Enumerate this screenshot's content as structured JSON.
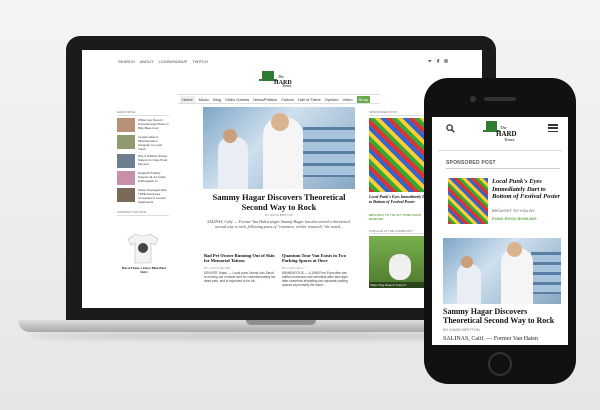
{
  "site": {
    "logo_top": "The",
    "logo_main": "HARD",
    "logo_bottom": "Times"
  },
  "desktop": {
    "topbar": [
      "SEARCH",
      "ABOUT",
      "LOGIN/SIGNUP",
      "TWITCH"
    ],
    "social_icons": [
      "twitter-icon",
      "facebook-icon",
      "instagram-icon"
    ],
    "nav": [
      "Home",
      "Music",
      "Blog",
      "Video Games",
      "News/Politics",
      "Culture",
      "Hall of Fame",
      "Opinion",
      "Video",
      "Shop"
    ],
    "sidebar": {
      "header": "HARD DRIVE",
      "items": [
        "White Guy Doesn't Know Enough Music to Play Bass Cool",
        "Cereal Label to Misinformation Gangster to Local Youth",
        "NCLU Publicly Shows Support for Fast Punk Moment",
        "Deathoft Publicly Support 11-12 Inside Enthusiastic to",
        "Sober Teenaged After TSPE Nominees Converted to Lenient Apartments"
      ],
      "support_header": "SUPPORT THE SITE!",
      "shirt_title": "Hard Times x Dave Blue Beer Shirt"
    },
    "hero": {
      "title": "Sammy Hagar Discovers Theoretical Second Way to Rock",
      "byline": "BY DAVID BRITTON",
      "excerpt": "SALINAS, Calif. — Former Van Halen singer Sammy Hagar has discovered a theoretical, second way to rock, following years of \"extensive, rockin' research,\" the noted..."
    },
    "subs": [
      {
        "title": "Bad Pet Owner Running Out of Skin for Memorial Tattoos",
        "meta": "BY LUCAS MEYER",
        "body": "DENVER, Mass. — Local punk Liberty Van Zandt is running out of blank skin for commemorating her dead pets, and is expected to be hit..."
      },
      {
        "title": "Quantum Tour Van Exists in Two Parking Spaces at Once",
        "meta": "BY LUKE KELLY",
        "body": "MINNEAPOLIS — A 1986 Ford Econoline van baffled onlookers and scientists alike last night after somehow inhabiting two separate parking spaces at precisely the same..."
      }
    ],
    "right": {
      "sponsored": "SPONSORED POST",
      "poster_title": "Local Punk's Eyes Immediately Dart to Bottom of Festival Poster",
      "brought": "BROUGHT TO YOU BY: PUNK ROCK BOWLING",
      "community": "POPULAR IN THE COMMUNITY",
      "dog_caption": "'Repo Dog Doesn't Know It"
    }
  },
  "phone": {
    "sponsored": "SPONSORED POST",
    "poster_title": "Local Punk's Eyes Immediately Dart to Bottom of Festival Poster",
    "brought": "BROUGHT TO YOU BY:",
    "sponsor": "PUNK ROCK BOWLING",
    "article_title": "Sammy Hagar Discovers Theoretical Second Way to Rock",
    "byline": "BY DAVID BRITTON",
    "body": "SALINAS, Calif. — Former Van Halen"
  }
}
